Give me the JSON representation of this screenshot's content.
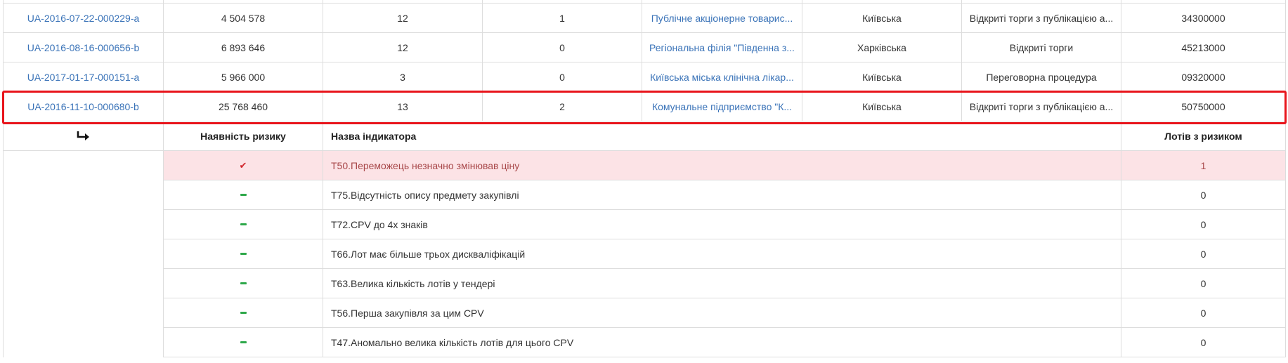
{
  "tenders": [
    {
      "id": "",
      "amount": "",
      "lots": "",
      "risks": "",
      "buyer": "",
      "region": "",
      "procedure": "",
      "cpv": ""
    },
    {
      "id": "UA-2016-07-22-000229-a",
      "amount": "4 504 578",
      "lots": "12",
      "risks": "1",
      "buyer": "Публічне акціонерне товарис...",
      "region": "Київська",
      "procedure": "Відкриті торги з публікацією а...",
      "cpv": "34300000"
    },
    {
      "id": "UA-2016-08-16-000656-b",
      "amount": "6 893 646",
      "lots": "12",
      "risks": "0",
      "buyer": "Регіональна філія \"Південна з...",
      "region": "Харківська",
      "procedure": "Відкриті торги",
      "cpv": "45213000"
    },
    {
      "id": "UA-2017-01-17-000151-a",
      "amount": "5 966 000",
      "lots": "3",
      "risks": "0",
      "buyer": "Київська міська клінічна лікар...",
      "region": "Київська",
      "procedure": "Переговорна процедура",
      "cpv": "09320000"
    },
    {
      "id": "UA-2016-11-10-000680-b",
      "amount": "25 768 460",
      "lots": "13",
      "risks": "2",
      "buyer": "Комунальне підприємство \"К...",
      "region": "Київська",
      "procedure": "Відкриті торги з публікацією а...",
      "cpv": "50750000"
    }
  ],
  "indicators_header": {
    "arrow_icon": "return-arrow-icon",
    "risk_presence": "Наявність ризику",
    "indicator_name": "Назва індикатора",
    "lots_with_risk": "Лотів з ризиком"
  },
  "indicators": [
    {
      "risk": true,
      "name": "Т50.Переможець незначно змінював ціну",
      "lots": "1"
    },
    {
      "risk": false,
      "name": "Т75.Відсутність опису предмету закупівлі",
      "lots": "0"
    },
    {
      "risk": false,
      "name": "Т72.CPV до 4х знаків",
      "lots": "0"
    },
    {
      "risk": false,
      "name": "Т66.Лот має більше трьох дискваліфікацій",
      "lots": "0"
    },
    {
      "risk": false,
      "name": "Т63.Велика кількість лотів у тендері",
      "lots": "0"
    },
    {
      "risk": false,
      "name": "Т56.Перша закупівля за цим CPV",
      "lots": "0"
    },
    {
      "risk": false,
      "name": "Т47.Аномально велика кількість лотів для цього CPV",
      "lots": "0"
    }
  ],
  "colors": {
    "link": "#3a73b8",
    "highlight": "#e8141b",
    "risk_row_bg": "#fce3e6",
    "check": "#d0262c",
    "dash": "#2ea84a"
  }
}
